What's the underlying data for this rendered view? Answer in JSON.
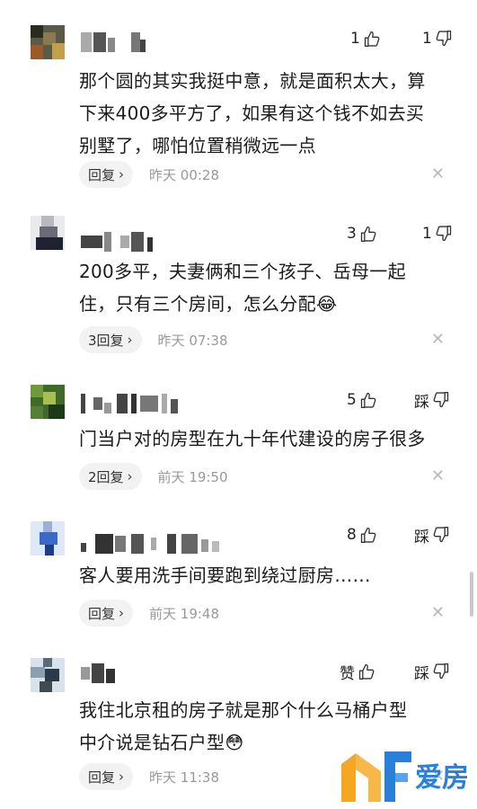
{
  "comments": [
    {
      "likes": "1",
      "dislikes": "1",
      "text_lines": [
        "那个圆的其实我挺中意，就是面积太大，算",
        "下来400多平方了，如果有这个钱不如去买",
        "别墅了，哪怕位置稍微远一点"
      ],
      "reply_label": "回复",
      "time": "昨天 00:28"
    },
    {
      "likes": "3",
      "dislikes": "1",
      "text_lines": [
        "200多平，夫妻俩和三个孩子、岳母一起",
        "住，只有三个房间，怎么分配😂"
      ],
      "reply_label": "3回复",
      "time": "昨天 07:38"
    },
    {
      "likes": "5",
      "dislikes": "踩",
      "text_lines": [
        "门当户对的房型在九十年代建设的房子很多"
      ],
      "reply_label": "2回复",
      "time": "前天 19:50"
    },
    {
      "likes": "8",
      "dislikes": "踩",
      "text_lines": [
        "客人要用洗手间要跑到绕过厨房……"
      ],
      "reply_label": "回复",
      "time": "前天 19:48"
    },
    {
      "likes": "赞",
      "dislikes": "踩",
      "text_lines": [
        "我住北京租的房子就是那个什么马桶户型",
        "中介说是钻石户型😳"
      ],
      "reply_label": "回复",
      "time": "昨天 11:38"
    }
  ],
  "icons": {
    "like": "thumbs-up-icon",
    "dislike": "thumbs-down-icon",
    "close": "close-icon",
    "chevron": "chevron-right-icon"
  },
  "watermark": {
    "text": "爱房",
    "colors": {
      "orange": "#f5a623",
      "blue": "#2a7fd9"
    }
  }
}
